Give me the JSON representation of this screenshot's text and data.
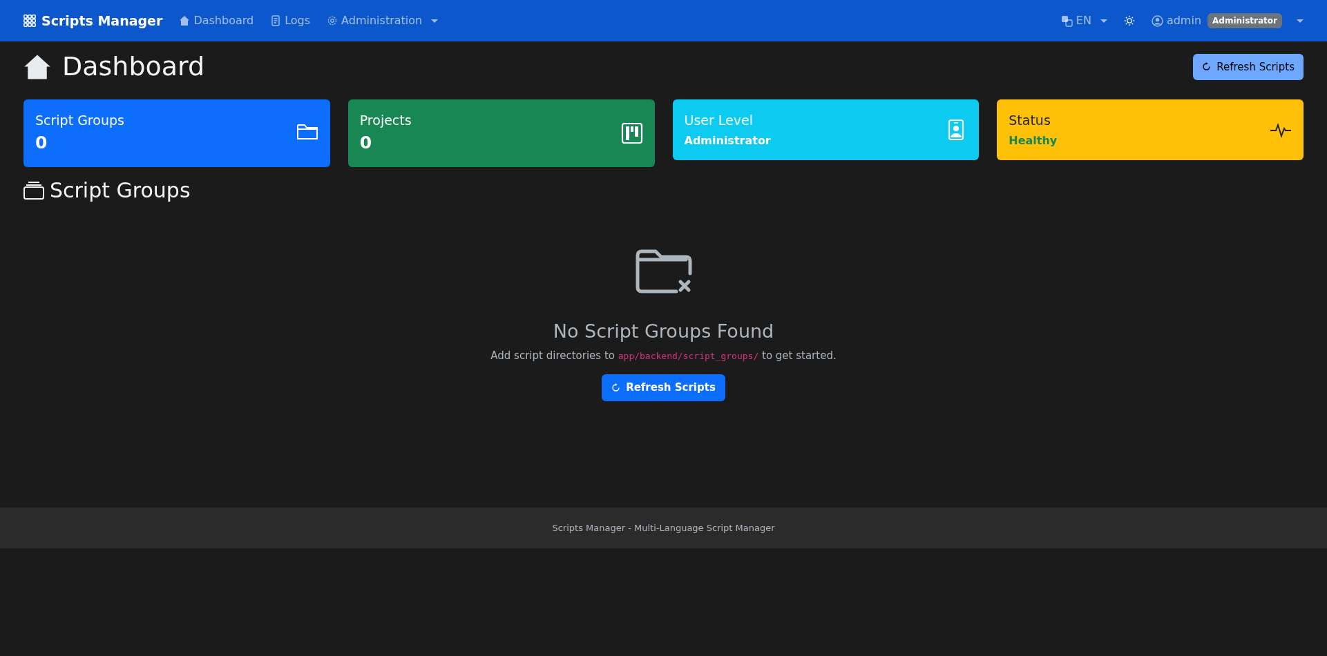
{
  "navbar": {
    "brand": "Scripts Manager",
    "items": [
      {
        "label": "Dashboard",
        "kind": "link"
      },
      {
        "label": "Logs",
        "kind": "link"
      },
      {
        "label": "Administration",
        "kind": "dropdown"
      }
    ],
    "language": "EN",
    "user": {
      "name": "admin",
      "role": "Administrator"
    }
  },
  "page": {
    "title": "Dashboard",
    "refresh_button": "Refresh Scripts"
  },
  "cards": [
    {
      "title": "Script Groups",
      "value": "0",
      "kind": "count",
      "color": "#0d6efd"
    },
    {
      "title": "Projects",
      "value": "0",
      "kind": "count",
      "color": "#198754"
    },
    {
      "title": "User Level",
      "value": "Administrator",
      "kind": "text",
      "color": "#0dcaf0"
    },
    {
      "title": "Status",
      "value": "Healthy",
      "kind": "status",
      "color": "#ffc107"
    }
  ],
  "section": {
    "title": "Script Groups"
  },
  "empty_state": {
    "title": "No Script Groups Found",
    "message_before": "Add script directories to",
    "path": "app/backend/script_groups/",
    "message_after": "to get started.",
    "button": "Refresh Scripts"
  },
  "footer": {
    "text": "Scripts Manager - Multi-Language Script Manager"
  }
}
